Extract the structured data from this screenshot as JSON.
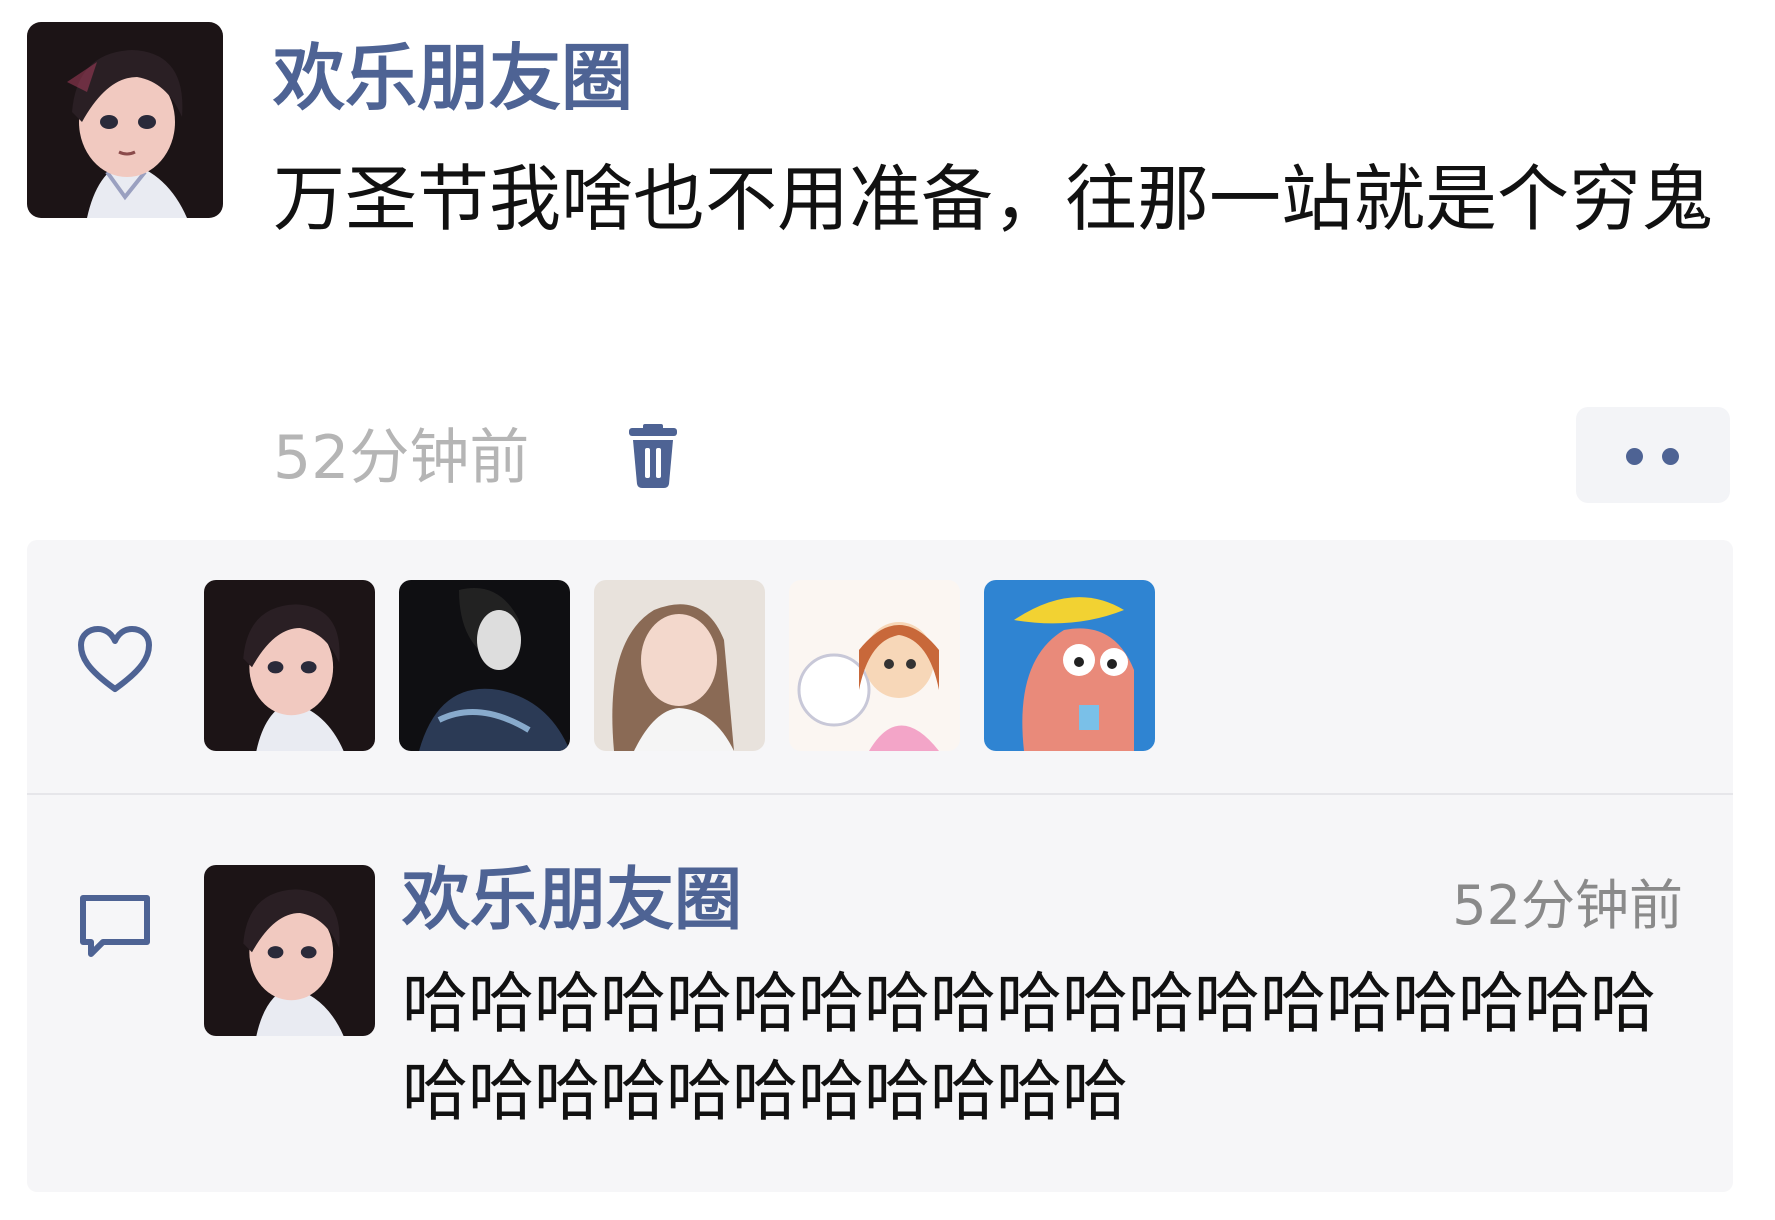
{
  "post": {
    "author": "欢乐朋友圈",
    "text": "万圣节我啥也不用准备，往那一站就是个穷鬼",
    "time": "52分钟前",
    "avatar": "anime-boy-avatar"
  },
  "actions": {
    "delete_icon": "trash-icon",
    "more_icon": "more-dots-icon"
  },
  "likes": {
    "icon": "heart-icon",
    "avatars": [
      {
        "name": "anime-boy-avatar"
      },
      {
        "name": "dark-figure-avatar"
      },
      {
        "name": "woman-photo-avatar"
      },
      {
        "name": "cartoon-girl-avatar"
      },
      {
        "name": "cartoon-fish-avatar"
      }
    ]
  },
  "comment": {
    "icon": "comment-icon",
    "author": "欢乐朋友圈",
    "time": "52分钟前",
    "text": "哈哈哈哈哈哈哈哈哈哈哈哈哈哈哈哈哈哈哈哈哈哈哈哈哈哈哈哈哈哈",
    "avatar": "anime-boy-avatar"
  },
  "colors": {
    "name_blue": "#4e6394",
    "panel_bg": "#f6f6f8",
    "time_gray": "#b5b5b5"
  }
}
